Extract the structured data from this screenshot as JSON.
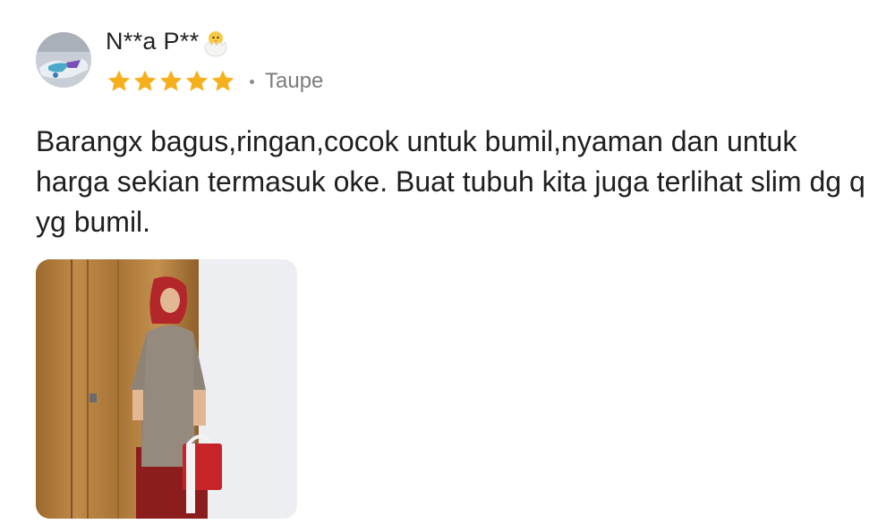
{
  "review": {
    "user_name": "N**a P**",
    "avatar_icon": "profile-photo-sneakers",
    "name_emoji": "hatching-chick-icon",
    "rating": 5,
    "rating_max": 5,
    "star_color": "#f6b01e",
    "variant": "Taupe",
    "text": "Barangx bagus,ringan,cocok untuk bumil,nyaman dan untuk harga sekian termasuk oke. Buat tubuh kita juga terlihat slim dg q yg bumil.",
    "photo_icon": "review-photo-woman-in-taupe-dress"
  }
}
